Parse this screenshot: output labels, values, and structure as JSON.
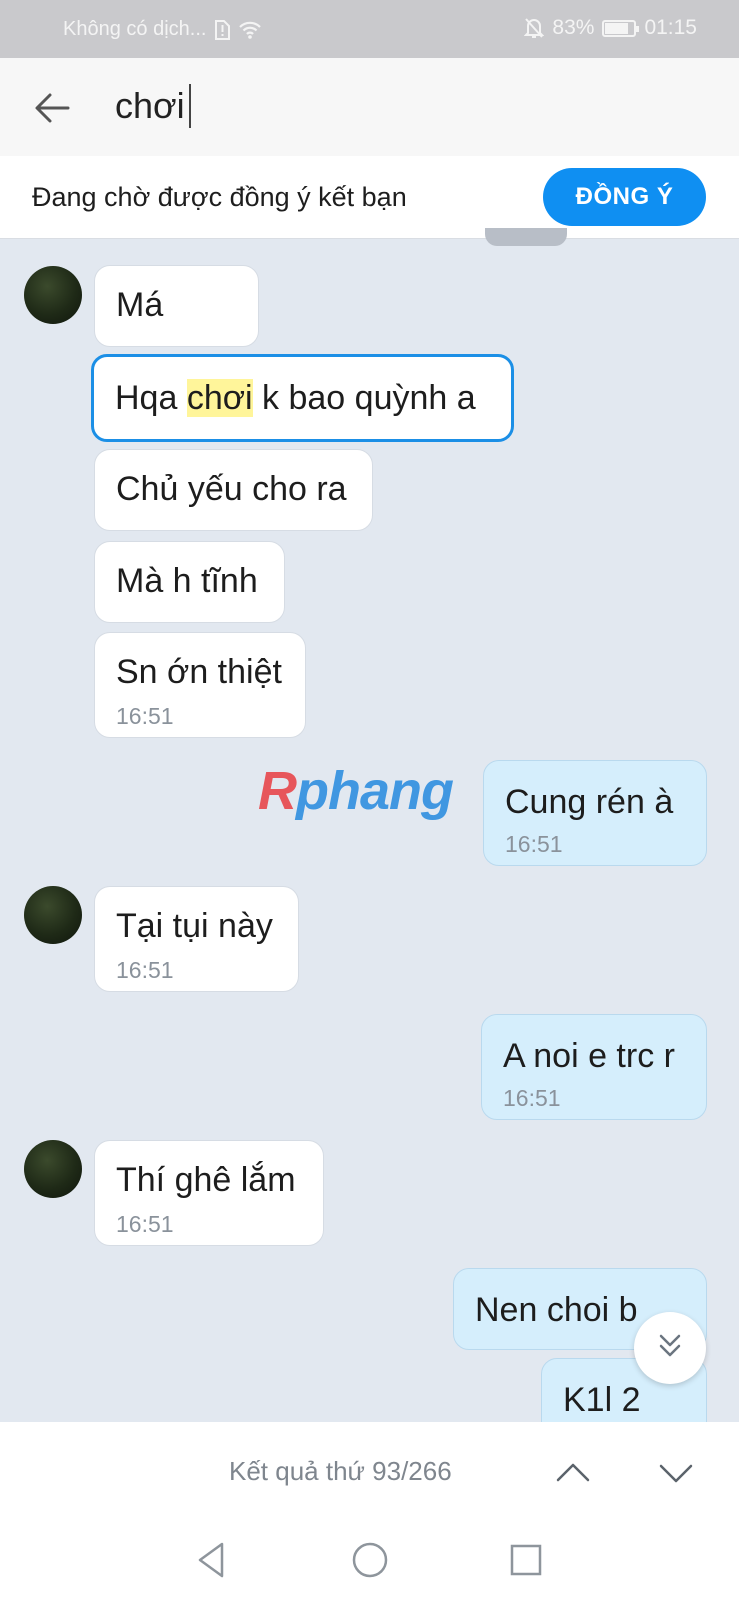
{
  "status_bar": {
    "carrier": "Không có dịch...",
    "battery": "83%",
    "battery_level": 0.83,
    "time": "01:15",
    "icons": [
      "sim-alert-icon",
      "wifi-icon",
      "bell-off-icon",
      "battery-icon"
    ]
  },
  "search": {
    "query": "chơi",
    "back_icon": "back-arrow-icon"
  },
  "friend_request": {
    "text": "Đang chờ được đồng ý kết bạn",
    "accept_label": "ĐỒNG Ý",
    "accept_color": "#0f8ff2"
  },
  "messages": [
    {
      "side": "in",
      "avatar": true,
      "text": "Má",
      "time": ""
    },
    {
      "side": "in",
      "text_before": "Hqa ",
      "highlight": "chơi",
      "text_after": " k bao quỳnh a",
      "highlighted_bubble": true
    },
    {
      "side": "in",
      "text": "Chủ yếu cho ra",
      "time": ""
    },
    {
      "side": "in",
      "text": "Mà h tĩnh",
      "time": ""
    },
    {
      "side": "in",
      "text": "Sn ớn thiệt",
      "time": "16:51"
    },
    {
      "side": "out",
      "text": "Cung rén à",
      "time": "16:51"
    },
    {
      "side": "in",
      "avatar": true,
      "text": "Tại tụi này",
      "time": "16:51"
    },
    {
      "side": "out",
      "text": "A noi e trc r",
      "time": "16:51"
    },
    {
      "side": "in",
      "avatar": true,
      "text": "Thí ghê lắm",
      "time": "16:51"
    },
    {
      "side": "out",
      "text": "Nen choi b",
      "time": ""
    },
    {
      "side": "out",
      "text": "K1l 2",
      "time": ""
    }
  ],
  "watermark": {
    "first": "R",
    "rest": "phang"
  },
  "scroll_button_icon": "double-chevron-down-icon",
  "results": {
    "text": "Kết quả thứ 93/266",
    "prev_icon": "chevron-up-icon",
    "next_icon": "chevron-down-icon"
  },
  "system_nav": {
    "icons": [
      "nav-back-icon",
      "nav-home-icon",
      "nav-recents-icon"
    ]
  },
  "colors": {
    "chat_bg": "#e2e8f0",
    "incoming_bubble": "#ffffff",
    "outgoing_bubble": "#d5eefc",
    "highlight_border": "#1b8fe6",
    "highlight_text_bg": "#fff59a"
  }
}
